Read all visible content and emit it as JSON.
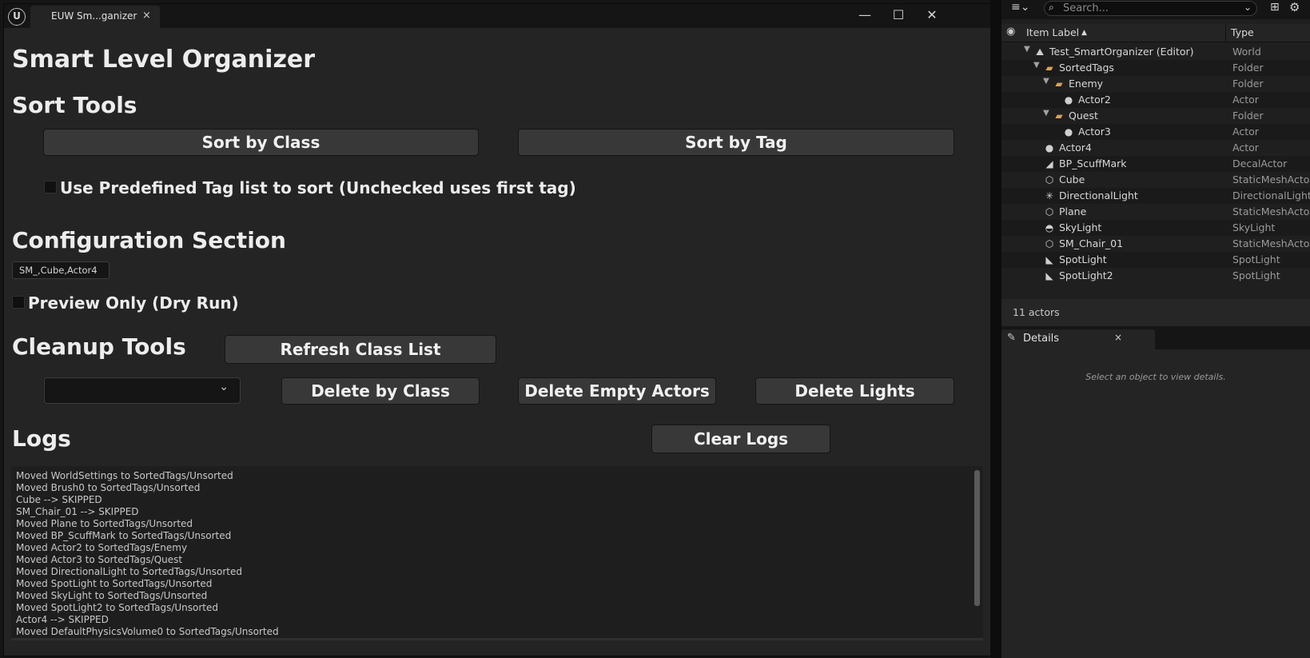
{
  "window": {
    "tab_label": "EUW Sm...ganizer",
    "close_tab": "×",
    "minimize": "—",
    "maximize": "☐",
    "close": "✕"
  },
  "page_title": "Smart Level Organizer",
  "sort_tools": {
    "heading": "Sort Tools",
    "sort_by_class": "Sort by Class",
    "sort_by_tag": "Sort by Tag",
    "use_predefined_label": "Use Predefined Tag list to sort (Unchecked uses first tag)",
    "use_predefined_checked": false
  },
  "configuration": {
    "heading": "Configuration Section",
    "tag_list_value": "SM_,Cube,Actor4",
    "preview_label": "Preview Only (Dry Run)",
    "preview_checked": false
  },
  "cleanup": {
    "heading": "Cleanup Tools",
    "refresh_class_list": "Refresh Class List",
    "class_dropdown_value": "",
    "delete_by_class": "Delete by Class",
    "delete_empty_actors": "Delete Empty Actors",
    "delete_lights": "Delete Lights"
  },
  "logs": {
    "heading": "Logs",
    "clear_logs": "Clear Logs",
    "lines": [
      "Moved WorldSettings to SortedTags/Unsorted",
      "Moved Brush0 to SortedTags/Unsorted",
      "Cube --> SKIPPED",
      "SM_Chair_01 --> SKIPPED",
      "Moved Plane to SortedTags/Unsorted",
      "Moved BP_ScuffMark to SortedTags/Unsorted",
      "Moved Actor2 to SortedTags/Enemy",
      "Moved Actor3 to SortedTags/Quest",
      "Moved DirectionalLight to SortedTags/Unsorted",
      "Moved SpotLight to SortedTags/Unsorted",
      "Moved SkyLight to SortedTags/Unsorted",
      "Moved SpotLight2 to SortedTags/Unsorted",
      "Actor4 --> SKIPPED",
      "Moved DefaultPhysicsVolume0 to SortedTags/Unsorted"
    ]
  },
  "outliner": {
    "search_placeholder": "Search...",
    "col_item_label": "Item Label",
    "sort_indicator": "▲",
    "col_type": "Type",
    "rows": [
      {
        "label": "Test_SmartOrganizer (Editor)",
        "type": "World",
        "icon": "world-icon"
      },
      {
        "label": "SortedTags",
        "type": "Folder",
        "icon": "folder-icon"
      },
      {
        "label": "Enemy",
        "type": "Folder",
        "icon": "folder-icon"
      },
      {
        "label": "Actor2",
        "type": "Actor",
        "icon": "actor-icon"
      },
      {
        "label": "Quest",
        "type": "Folder",
        "icon": "folder-icon"
      },
      {
        "label": "Actor3",
        "type": "Actor",
        "icon": "actor-icon"
      },
      {
        "label": "Actor4",
        "type": "Actor",
        "icon": "actor-icon"
      },
      {
        "label": "BP_ScuffMark",
        "type": "DecalActor",
        "icon": "decal-icon"
      },
      {
        "label": "Cube",
        "type": "StaticMeshActor",
        "icon": "static-mesh-icon"
      },
      {
        "label": "DirectionalLight",
        "type": "DirectionalLight",
        "icon": "directional-light-icon"
      },
      {
        "label": "Plane",
        "type": "StaticMeshActor",
        "icon": "static-mesh-icon"
      },
      {
        "label": "SkyLight",
        "type": "SkyLight",
        "icon": "sky-light-icon"
      },
      {
        "label": "SM_Chair_01",
        "type": "StaticMeshActor",
        "icon": "static-mesh-icon"
      },
      {
        "label": "SpotLight",
        "type": "SpotLight",
        "icon": "spot-light-icon"
      },
      {
        "label": "SpotLight2",
        "type": "SpotLight",
        "icon": "spot-light-icon"
      }
    ],
    "actor_count": "11 actors"
  },
  "details": {
    "tab_label": "Details",
    "close_tab": "×",
    "empty_message": "Select an object to view details."
  },
  "colors": {
    "background": "#242424",
    "button": "#383838",
    "folder": "#d8a25a"
  }
}
